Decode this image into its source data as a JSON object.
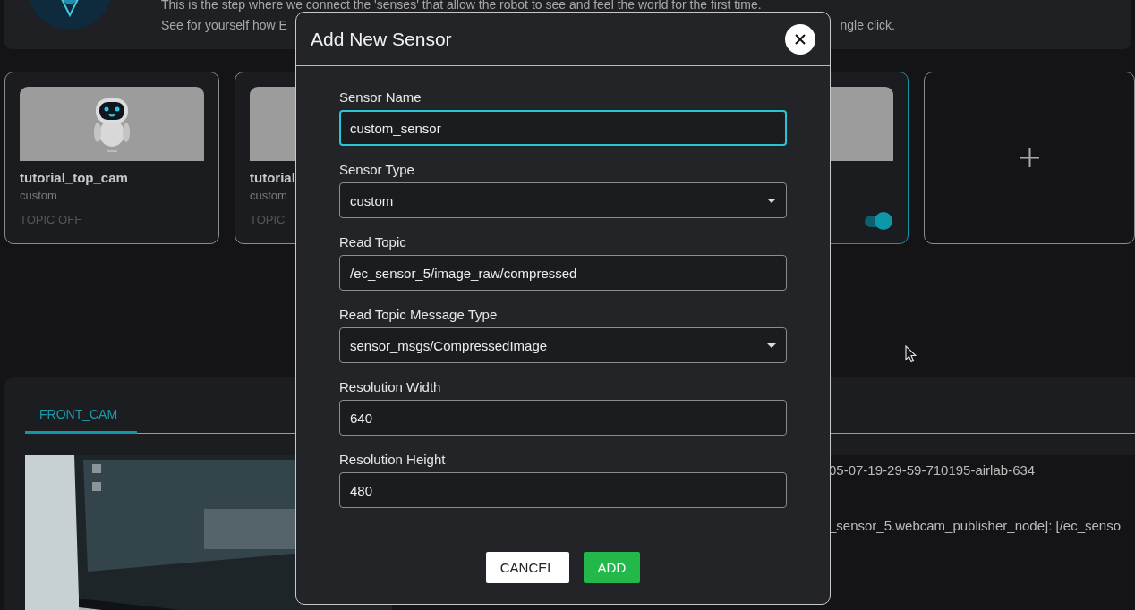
{
  "header": {
    "intro": "This is the step where we connect the 'senses' that allow the robot to see and feel the world for the first time.",
    "second_line_parts": [
      "See for yourself how E",
      "ngle click."
    ]
  },
  "sensor_cards": [
    {
      "name": "tutorial_top_cam",
      "type": "custom",
      "status": "TOPIC OFF",
      "selected": false,
      "kind": "robot"
    },
    {
      "name": "tutorial",
      "type": "custom",
      "status": "TOPIC",
      "selected": false,
      "kind": "plain"
    },
    {
      "selected": true,
      "kind": "plain",
      "toggle_on": true
    }
  ],
  "camera_panel": {
    "tabs": [
      {
        "label": "FRONT_CAM",
        "selected": true
      }
    ],
    "log_lines": [
      "05-07-19-29-59-710195-airlab-634",
      "_sensor_5.webcam_publisher_node]: [/ec_senso"
    ]
  },
  "dialog": {
    "title": "Add New Sensor",
    "fields": [
      {
        "label": "Sensor Name",
        "value": "custom_sensor",
        "kind": "text",
        "focused": true
      },
      {
        "label": "Sensor Type",
        "value": "custom",
        "kind": "select",
        "focused": false
      },
      {
        "label": "Read Topic",
        "value": "/ec_sensor_5/image_raw/compressed",
        "kind": "text",
        "focused": false
      },
      {
        "label": "Read Topic Message Type",
        "value": "sensor_msgs/CompressedImage",
        "kind": "select",
        "focused": false
      },
      {
        "label": "Resolution Width",
        "value": "640",
        "kind": "text",
        "focused": false
      },
      {
        "label": "Resolution Height",
        "value": "480",
        "kind": "text",
        "focused": false
      }
    ],
    "buttons": [
      {
        "label": "CANCEL",
        "kind": "secondary"
      },
      {
        "label": "ADD",
        "kind": "primary"
      }
    ]
  }
}
